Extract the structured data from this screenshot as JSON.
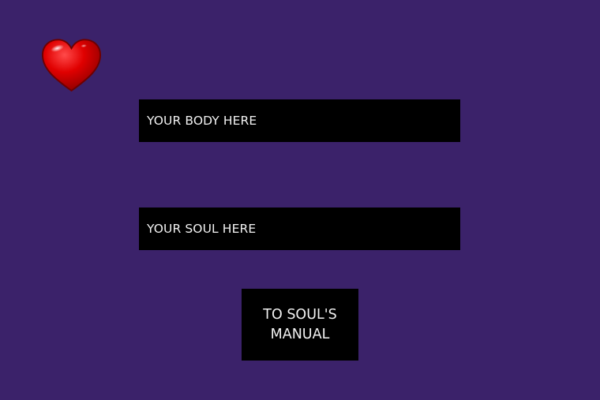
{
  "app": {
    "background_color": "#3b226a",
    "logo_icon": "heart-icon",
    "heart_color": "#e00000"
  },
  "form": {
    "body_field": {
      "value": "",
      "placeholder": "YOUR BODY HERE"
    },
    "soul_field": {
      "value": "",
      "placeholder": "YOUR SOUL HERE"
    }
  },
  "actions": {
    "manual_button_label": "TO SOUL'S MANUAL"
  }
}
